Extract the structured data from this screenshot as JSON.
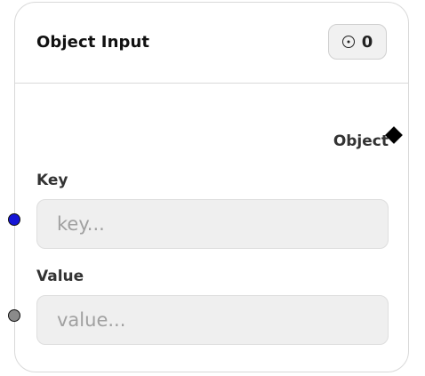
{
  "node": {
    "title": "Object Input",
    "badge_count": "0",
    "badge_icon": "circle-dot-icon",
    "output": {
      "label": "Object",
      "handle_icon": "diamond-handle-icon",
      "handle_color": "#000000"
    },
    "fields": [
      {
        "label": "Key",
        "placeholder": "key...",
        "value": "",
        "handle_color": "#1515d6"
      },
      {
        "label": "Value",
        "placeholder": "value...",
        "value": "",
        "handle_color": "#8a8a8a"
      }
    ]
  }
}
